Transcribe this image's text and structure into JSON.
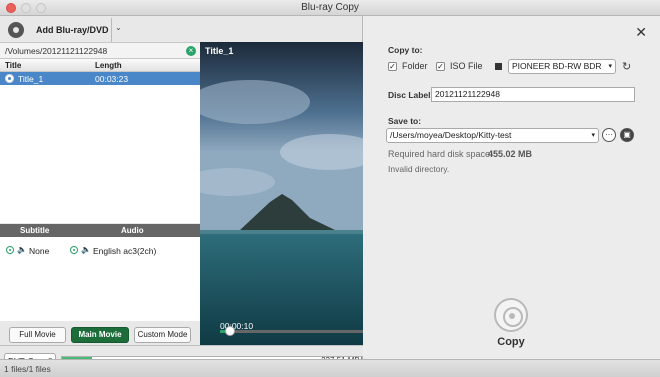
{
  "window": {
    "title": "Blu-ray Copy"
  },
  "toolbar": {
    "add_label": "Add Blu-ray/DVD"
  },
  "source": {
    "path": "/Volumes/20121121122948"
  },
  "title_list": {
    "headers": {
      "title": "Title",
      "length": "Length"
    },
    "rows": [
      {
        "title": "Title_1",
        "length": "00:03:23"
      }
    ]
  },
  "tracks": {
    "subtitle_header": "Subtitle",
    "audio_header": "Audio",
    "subtitle_value": "None",
    "audio_value": "English ac3(2ch)"
  },
  "modes": {
    "full": "Full Movie",
    "main": "Main Movie",
    "custom": "Custom Mode",
    "selected": "Main Movie"
  },
  "preview": {
    "title": "Title_1",
    "time": "00:00:10",
    "position": 0.07
  },
  "output": {
    "disc_type": "DVD-5",
    "size_text": "227.51 MB/",
    "fill": 0.1
  },
  "status": {
    "files": "1 files/1 files"
  },
  "settings": {
    "copy_to_label": "Copy to:",
    "folder_label": "Folder",
    "folder_checked": true,
    "iso_label": "ISO File",
    "iso_checked": true,
    "drive": "PIONEER BD-RW   BDR",
    "disc_label_label": "Disc Label:",
    "disc_label_value": "20121121122948",
    "save_to_label": "Save to:",
    "save_path": "/Users/moyea/Desktop/Kitty-test",
    "required_label": "Required hard disk space:",
    "required_value": "455.02 MB",
    "invalid_text": "Invalid directory.",
    "copy_button": "Copy"
  },
  "colors": {
    "accent": "#1d6d3b",
    "selection": "#4a87c9",
    "progress": "#2aa36a"
  }
}
